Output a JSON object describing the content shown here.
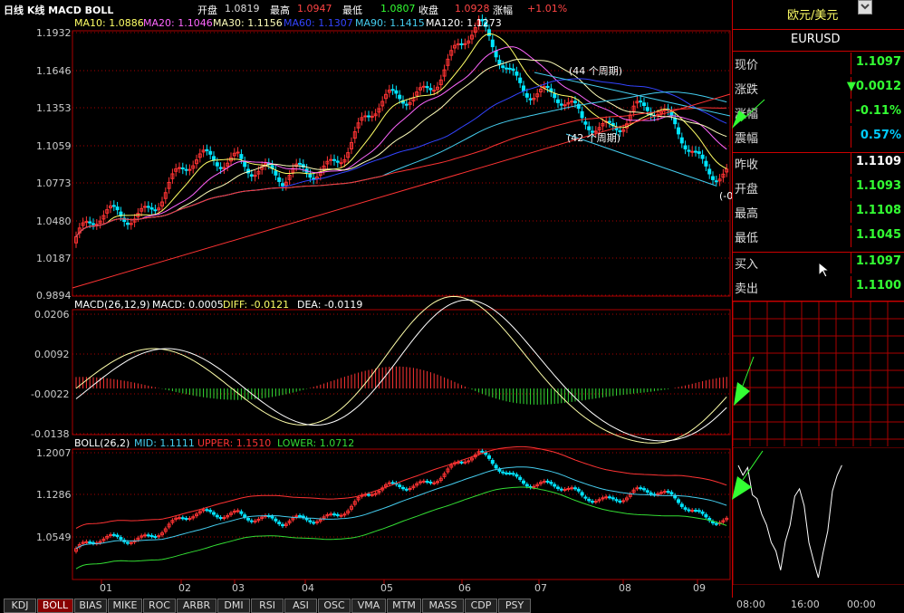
{
  "header": {
    "title": "日线 K线 MACD BOLL",
    "open_label": "开盘",
    "open_value": "1.0819",
    "high_label": "最高",
    "high_value": "1.0947",
    "low_label": "最低",
    "low_value": "1.0807",
    "close_label": "收盘",
    "close_value": "1.0928",
    "change_label": "涨幅",
    "change_value": "+1.01%"
  },
  "ma_legend": {
    "ma10": "MA10: 1.0886",
    "ma20": "MA20: 1.1046",
    "ma30": "MA30: 1.1156",
    "ma60": "MA60: 1.1307",
    "ma90": "MA90: 1.1415",
    "ma120": "MA120: 1.1273"
  },
  "macd_legend": {
    "name": "MACD(26,12,9)",
    "macd": "MACD: 0.0005",
    "diff": "DIFF: -0.0121",
    "dea": "DEA: -0.0119"
  },
  "boll_legend": {
    "name": "BOLL(26,2)",
    "mid": "MID: 1.1111",
    "upper": "UPPER: 1.1510",
    "lower": "LOWER: 1.0712"
  },
  "annotations": {
    "a1": "(44 个周期)",
    "a2": "(42 个周期)",
    "a3": "(-0"
  },
  "price_axis": [
    "1.1932",
    "1.1646",
    "1.1353",
    "1.1059",
    "1.0773",
    "1.0480",
    "1.0187",
    "0.9894"
  ],
  "macd_axis": [
    "0.0206",
    "0.0092",
    "-0.0022",
    "-0.0138"
  ],
  "boll_axis": [
    "1.2007",
    "1.1286",
    "1.0549"
  ],
  "month_axis": [
    "01",
    "02",
    "03",
    "04",
    "05",
    "06",
    "07",
    "08",
    "09"
  ],
  "quote": {
    "symbol_cn": "欧元/美元",
    "symbol": "EURUSD",
    "rows1": [
      {
        "label": "现价",
        "value": "1.1097"
      },
      {
        "label": "涨跌",
        "value": "▼0.0012"
      },
      {
        "label": "涨幅",
        "value": "-0.11%"
      },
      {
        "label": "震幅",
        "value": "0.57%"
      }
    ],
    "rows2": [
      {
        "label": "昨收",
        "value": "1.1109"
      },
      {
        "label": "开盘",
        "value": "1.1093"
      },
      {
        "label": "最高",
        "value": "1.1108"
      },
      {
        "label": "最低",
        "value": "1.1045"
      }
    ],
    "rows3": [
      {
        "label": "买入",
        "value": "1.1097"
      },
      {
        "label": "卖出",
        "value": "1.1100"
      }
    ]
  },
  "intraday_axis": [
    "08:00",
    "16:00",
    "00:00"
  ],
  "tabs": [
    "KDJ",
    "BOLL",
    "BIAS",
    "MIKE",
    "ROC",
    "ARBR",
    "DMI",
    "RSI",
    "ASI",
    "OSC",
    "VMA",
    "MTM",
    "MASS",
    "CDP",
    "PSY"
  ],
  "active_tab": "BOLL",
  "colors": {
    "up": "#ff3333",
    "down": "#00e5ff",
    "ma10": "#ffff66",
    "ma20": "#ff66ff",
    "ma30": "#ffffbb",
    "ma60": "#3344ff",
    "ma90": "#44ccee",
    "ma120": "#ff3333",
    "grid": "#aa0000",
    "boll_mid": "#44ccee",
    "boll_upper": "#ff3333",
    "boll_lower": "#33dd33"
  }
}
